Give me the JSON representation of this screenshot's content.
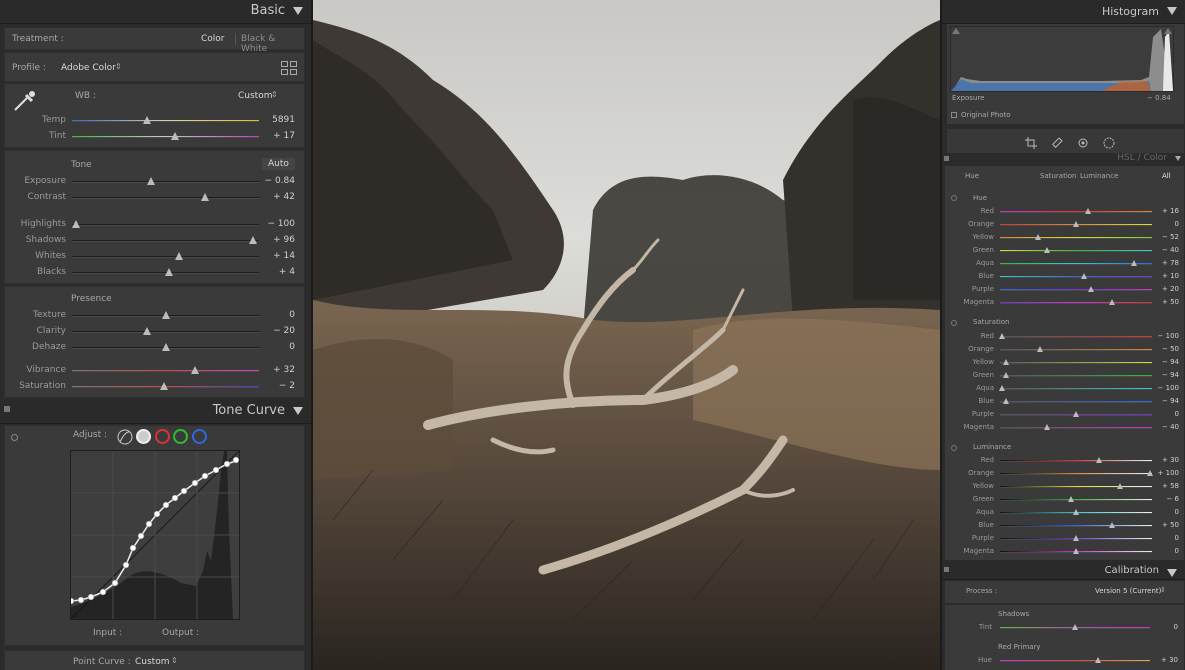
{
  "basic": {
    "title": "Basic",
    "treatment_label": "Treatment :",
    "treatment_color": "Color",
    "treatment_bw": "Black & White",
    "profile_label": "Profile :",
    "profile_value": "Adobe Color",
    "wb_label": "WB :",
    "wb_value": "Custom",
    "tone_label": "Tone",
    "auto_label": "Auto",
    "presence_label": "Presence",
    "sliders": [
      {
        "label": "Temp",
        "value": "5891",
        "pos": 0.4
      },
      {
        "label": "Tint",
        "value": "+ 17",
        "pos": 0.55
      },
      {
        "label": "Exposure",
        "value": "− 0.84",
        "pos": 0.42
      },
      {
        "label": "Contrast",
        "value": "+ 42",
        "pos": 0.71
      },
      {
        "label": "Highlights",
        "value": "− 100",
        "pos": 0.02
      },
      {
        "label": "Shadows",
        "value": "+ 96",
        "pos": 0.97
      },
      {
        "label": "Whites",
        "value": "+ 14",
        "pos": 0.57
      },
      {
        "label": "Blacks",
        "value": "+ 4",
        "pos": 0.52
      },
      {
        "label": "Texture",
        "value": "0",
        "pos": 0.5
      },
      {
        "label": "Clarity",
        "value": "− 20",
        "pos": 0.4
      },
      {
        "label": "Dehaze",
        "value": "0",
        "pos": 0.5
      },
      {
        "label": "Vibrance",
        "value": "+ 32",
        "pos": 0.66
      },
      {
        "label": "Saturation",
        "value": "− 2",
        "pos": 0.49
      }
    ]
  },
  "tone_curve": {
    "title": "Tone Curve",
    "adjust_label": "Adjust :",
    "input_label": "Input :",
    "output_label": "Output :",
    "point_curve_label": "Point Curve :",
    "point_curve_value": "Custom"
  },
  "histogram": {
    "title": "Histogram",
    "exposure_label": "Exposure",
    "exposure_value": "− 0.84",
    "original_photo_label": "Original Photo"
  },
  "hsl": {
    "title": "HSL / Color",
    "tabs": [
      "Hue",
      "Saturation",
      "Luminance",
      "All"
    ],
    "hue_title": "Hue",
    "saturation_title": "Saturation",
    "luminance_title": "Luminance",
    "hue": [
      {
        "label": "Red",
        "value": "+ 16",
        "pos": 0.58
      },
      {
        "label": "Orange",
        "value": "0",
        "pos": 0.5
      },
      {
        "label": "Yellow",
        "value": "− 52",
        "pos": 0.25
      },
      {
        "label": "Green",
        "value": "− 40",
        "pos": 0.31
      },
      {
        "label": "Aqua",
        "value": "+ 78",
        "pos": 0.88
      },
      {
        "label": "Blue",
        "value": "+ 10",
        "pos": 0.55
      },
      {
        "label": "Purple",
        "value": "+ 20",
        "pos": 0.6
      },
      {
        "label": "Magenta",
        "value": "+ 50",
        "pos": 0.74
      }
    ],
    "saturation": [
      {
        "label": "Red",
        "value": "− 100",
        "pos": 0.01
      },
      {
        "label": "Orange",
        "value": "− 50",
        "pos": 0.26
      },
      {
        "label": "Yellow",
        "value": "− 94",
        "pos": 0.04
      },
      {
        "label": "Green",
        "value": "− 94",
        "pos": 0.04
      },
      {
        "label": "Aqua",
        "value": "− 100",
        "pos": 0.01
      },
      {
        "label": "Blue",
        "value": "− 94",
        "pos": 0.04
      },
      {
        "label": "Purple",
        "value": "0",
        "pos": 0.5
      },
      {
        "label": "Magenta",
        "value": "− 40",
        "pos": 0.31
      }
    ],
    "luminance": [
      {
        "label": "Red",
        "value": "+ 30",
        "pos": 0.65
      },
      {
        "label": "Orange",
        "value": "+ 100",
        "pos": 0.99
      },
      {
        "label": "Yellow",
        "value": "+ 58",
        "pos": 0.79
      },
      {
        "label": "Green",
        "value": "− 6",
        "pos": 0.47
      },
      {
        "label": "Aqua",
        "value": "0",
        "pos": 0.5
      },
      {
        "label": "Blue",
        "value": "+ 50",
        "pos": 0.74
      },
      {
        "label": "Purple",
        "value": "0",
        "pos": 0.5
      },
      {
        "label": "Magenta",
        "value": "0",
        "pos": 0.5
      }
    ]
  },
  "calibration": {
    "title": "Calibration",
    "process_label": "Process :",
    "process_value": "Version 5 (Current)",
    "shadows_label": "Shadows",
    "tint_label": "Tint",
    "tint_value": "0",
    "tint_pos": 0.5,
    "red_primary_label": "Red Primary",
    "hue_label": "Hue",
    "hue_value": "+ 30",
    "hue_pos": 0.65
  }
}
